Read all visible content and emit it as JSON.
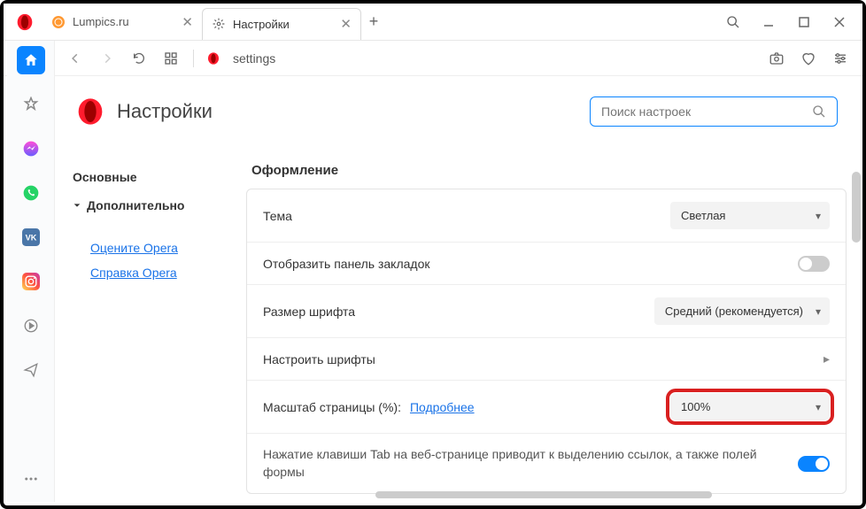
{
  "tabs": [
    {
      "title": "Lumpics.ru",
      "icon": "orange"
    },
    {
      "title": "Настройки",
      "icon": "gear"
    }
  ],
  "address": "settings",
  "page": {
    "title": "Настройки",
    "search_placeholder": "Поиск настроек"
  },
  "nav": {
    "main": "Основные",
    "advanced": "Дополнительно",
    "rate": "Оцените Opera",
    "help": "Справка Opera"
  },
  "section": {
    "title": "Оформление",
    "theme_label": "Тема",
    "theme_value": "Светлая",
    "bookmarks_label": "Отобразить панель закладок",
    "fontsize_label": "Размер шрифта",
    "fontsize_value": "Средний (рекомендуется)",
    "fonts_label": "Настроить шрифты",
    "zoom_label": "Масштаб страницы (%):",
    "zoom_link": "Подробнее",
    "zoom_value": "100%",
    "tab_label": "Нажатие клавиши Tab на веб-странице приводит к выделению ссылок, а также полей формы"
  }
}
